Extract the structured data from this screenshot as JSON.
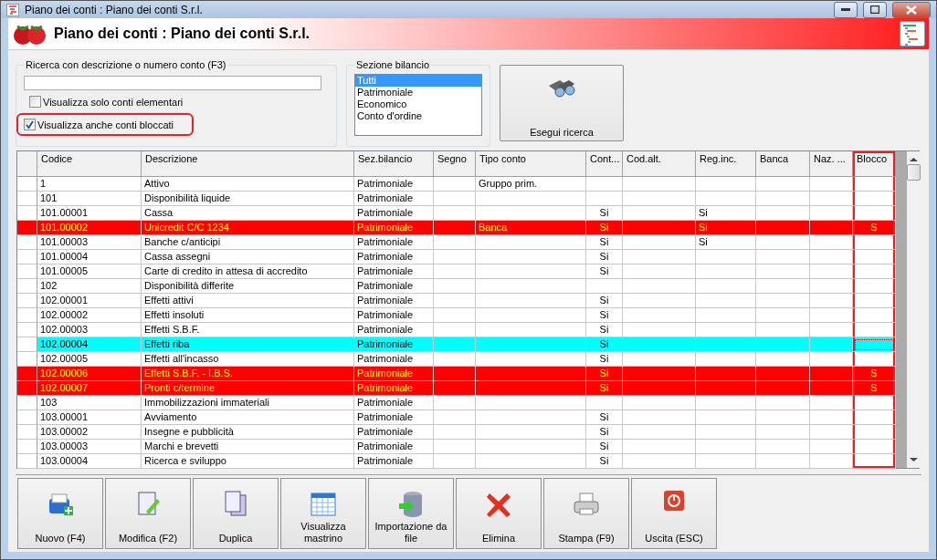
{
  "window": {
    "title": "Piano dei conti : Piano dei conti S.r.l."
  },
  "header": {
    "title": "Piano dei conti : Piano dei conti S.r.l."
  },
  "search": {
    "legend": "Ricerca con descrizione o numero conto (F3)"
  },
  "checkboxes": [
    {
      "label": "Visualizza solo conti elementari",
      "checked": false,
      "highlighted": false
    },
    {
      "label": "Visualizza anche conti bloccati",
      "checked": true,
      "highlighted": true
    }
  ],
  "section": {
    "legend": "Sezione bilancio",
    "items": [
      {
        "label": "Tutti",
        "selected": true
      },
      {
        "label": "Patrimoniale",
        "selected": false
      },
      {
        "label": "Economico",
        "selected": false
      },
      {
        "label": "Conto d'ordine",
        "selected": false
      }
    ]
  },
  "search_button": {
    "label": "Esegui ricerca"
  },
  "table": {
    "columns": [
      {
        "label": "Codice",
        "kind": "text",
        "highlighted": false
      },
      {
        "label": "Descrizione",
        "kind": "text",
        "highlighted": false
      },
      {
        "label": "Sez.bilancio",
        "kind": "text",
        "highlighted": false
      },
      {
        "label": "Segno",
        "kind": "text",
        "highlighted": false
      },
      {
        "label": "Tipo conto",
        "kind": "text",
        "highlighted": false
      },
      {
        "label": "Cont...",
        "kind": "flag",
        "highlighted": false
      },
      {
        "label": "Cod.alt.",
        "kind": "text",
        "highlighted": false
      },
      {
        "label": "Reg.inc.",
        "kind": "text",
        "highlighted": false
      },
      {
        "label": "Banca",
        "kind": "text",
        "highlighted": false
      },
      {
        "label": "Naz. ...",
        "kind": "text",
        "highlighted": false
      },
      {
        "label": "Blocco",
        "kind": "flag",
        "highlighted": true
      }
    ],
    "rows": [
      {
        "cells": [
          "1",
          "Attivo",
          "Patrimoniale",
          null,
          "Gruppo prim.",
          null,
          null,
          null,
          null,
          null,
          null
        ],
        "blocked": false,
        "selected": false
      },
      {
        "cells": [
          "101",
          "Disponibilità liquide",
          "Patrimoniale",
          null,
          null,
          null,
          null,
          null,
          null,
          null,
          null
        ],
        "blocked": false,
        "selected": false
      },
      {
        "cells": [
          "101.00001",
          "Cassa",
          "Patrimoniale",
          null,
          null,
          "Si",
          null,
          "Si",
          null,
          null,
          null
        ],
        "blocked": false,
        "selected": false
      },
      {
        "cells": [
          "101.00002",
          "Unicredit C/C 1234",
          "Patrimoniale",
          null,
          "Banca",
          "Si",
          null,
          "Si",
          null,
          null,
          "S"
        ],
        "blocked": true,
        "selected": false
      },
      {
        "cells": [
          "101.00003",
          "Banche c/anticipi",
          "Patrimoniale",
          null,
          null,
          "Si",
          null,
          "Si",
          null,
          null,
          null
        ],
        "blocked": false,
        "selected": false
      },
      {
        "cells": [
          "101.00004",
          "Cassa assegni",
          "Patrimoniale",
          null,
          null,
          "Si",
          null,
          null,
          null,
          null,
          null
        ],
        "blocked": false,
        "selected": false
      },
      {
        "cells": [
          "101.00005",
          "Carte di credito in attesa di accredito",
          "Patrimoniale",
          null,
          null,
          "Si",
          null,
          null,
          null,
          null,
          null
        ],
        "blocked": false,
        "selected": false
      },
      {
        "cells": [
          "102",
          "Disponibilità differite",
          "Patrimoniale",
          null,
          null,
          null,
          null,
          null,
          null,
          null,
          null
        ],
        "blocked": false,
        "selected": false
      },
      {
        "cells": [
          "102.00001",
          "Effetti attivi",
          "Patrimoniale",
          null,
          null,
          "Si",
          null,
          null,
          null,
          null,
          null
        ],
        "blocked": false,
        "selected": false
      },
      {
        "cells": [
          "102.00002",
          "Effetti insoluti",
          "Patrimoniale",
          null,
          null,
          "Si",
          null,
          null,
          null,
          null,
          null
        ],
        "blocked": false,
        "selected": false
      },
      {
        "cells": [
          "102.00003",
          "Effetti S.B.F.",
          "Patrimoniale",
          null,
          null,
          "Si",
          null,
          null,
          null,
          null,
          null
        ],
        "blocked": false,
        "selected": false
      },
      {
        "cells": [
          "102.00004",
          "Effetti riba",
          "Patrimoniale",
          null,
          null,
          "Si",
          null,
          null,
          null,
          null,
          null
        ],
        "blocked": false,
        "selected": true
      },
      {
        "cells": [
          "102.00005",
          "Effetti all'incasso",
          "Patrimoniale",
          null,
          null,
          "Si",
          null,
          null,
          null,
          null,
          null
        ],
        "blocked": false,
        "selected": false
      },
      {
        "cells": [
          "102.00006",
          "Effetti S.B.F. - I.B.S.",
          "Patrimoniale",
          null,
          null,
          "Si",
          null,
          null,
          null,
          null,
          "S"
        ],
        "blocked": true,
        "selected": false
      },
      {
        "cells": [
          "102.00007",
          "Pronti c/termine",
          "Patrimoniale",
          null,
          null,
          "Si",
          null,
          null,
          null,
          null,
          "S"
        ],
        "blocked": true,
        "selected": false
      },
      {
        "cells": [
          "103",
          "Immobilizzazioni immateriali",
          "Patrimoniale",
          null,
          null,
          null,
          null,
          null,
          null,
          null,
          null
        ],
        "blocked": false,
        "selected": false
      },
      {
        "cells": [
          "103.00001",
          "Avviamento",
          "Patrimoniale",
          null,
          null,
          "Si",
          null,
          null,
          null,
          null,
          null
        ],
        "blocked": false,
        "selected": false
      },
      {
        "cells": [
          "103.00002",
          "Insegne e pubblicità",
          "Patrimoniale",
          null,
          null,
          "Si",
          null,
          null,
          null,
          null,
          null
        ],
        "blocked": false,
        "selected": false
      },
      {
        "cells": [
          "103.00003",
          "Marchi e brevetti",
          "Patrimoniale",
          null,
          null,
          "Si",
          null,
          null,
          null,
          null,
          null
        ],
        "blocked": false,
        "selected": false
      },
      {
        "cells": [
          "103.00004",
          "Ricerca e sviluppo",
          "Patrimoniale",
          null,
          null,
          "Si",
          null,
          null,
          null,
          null,
          null
        ],
        "blocked": false,
        "selected": false
      }
    ]
  },
  "buttons": [
    {
      "label": "Nuovo (F4)"
    },
    {
      "label": "Modifica (F2)"
    },
    {
      "label": "Duplica"
    },
    {
      "label": "Visualizza mastrino"
    },
    {
      "label": "Importazione da file"
    },
    {
      "label": "Elimina"
    },
    {
      "label": "Stampa (F9)"
    },
    {
      "label": "Uscita (ESC)"
    }
  ]
}
